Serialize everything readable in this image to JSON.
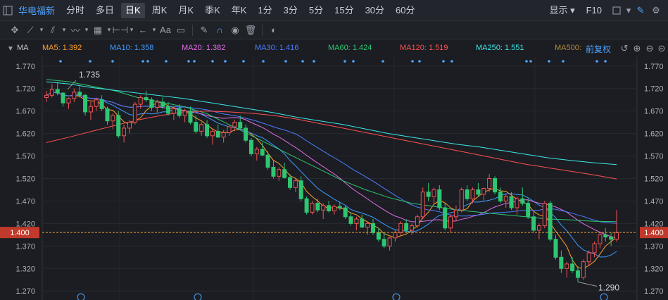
{
  "toolbar": {
    "stock_name": "华电福新",
    "periods": [
      "分时",
      "多日",
      "日K",
      "周K",
      "月K",
      "季K",
      "年K",
      "1分",
      "3分",
      "5分",
      "15分",
      "30分",
      "60分"
    ],
    "active_period": "日K",
    "display_label": "显示",
    "f10_label": "F10",
    "draw_tools": [
      "cursor-icon",
      "line-icon",
      "channel-icon",
      "wave-icon",
      "measure-icon",
      "interval-icon",
      "arrow-left-icon",
      "text-icon",
      "comment-icon",
      "pen-icon",
      "magnet-icon",
      "eye-icon",
      "trash-icon",
      "toggle-icon"
    ],
    "text_tool_label": "Aa"
  },
  "ma_bar": {
    "indicator": "MA",
    "items": [
      {
        "label": "MA5: 1.392",
        "color": "#ff9f2e"
      },
      {
        "label": "MA10: 1.358",
        "color": "#3d9bff"
      },
      {
        "label": "MA20: 1.382",
        "color": "#e26ee8"
      },
      {
        "label": "MA30: 1.416",
        "color": "#4a7dff"
      },
      {
        "label": "MA60: 1.424",
        "color": "#2ec672"
      },
      {
        "label": "MA120: 1.519",
        "color": "#ff5050"
      },
      {
        "label": "MA250: 1.551",
        "color": "#3ee6e6"
      },
      {
        "label": "MA500:",
        "color": "#b08a3a"
      }
    ],
    "adjust_label": "前复权",
    "controls": [
      "undo-icon",
      "zoom-in-icon",
      "zoom-out-icon",
      "minus-icon"
    ]
  },
  "chart_data": {
    "type": "candlestick",
    "y_ticks": [
      "1.770",
      "1.720",
      "1.670",
      "1.620",
      "1.570",
      "1.520",
      "1.470",
      "1.420",
      "1.370",
      "1.320",
      "1.270"
    ],
    "ylim": [
      1.25,
      1.79
    ],
    "current_price": "1.400",
    "annotations": [
      {
        "label": "1.735",
        "value": 1.735
      },
      {
        "label": "1.290",
        "value": 1.29
      }
    ],
    "up_color": "#f05454",
    "down_color": "#2ec672",
    "candles": [
      [
        1.7,
        1.715,
        1.69,
        1.705
      ],
      [
        1.705,
        1.73,
        1.7,
        1.718
      ],
      [
        1.718,
        1.735,
        1.705,
        1.71
      ],
      [
        1.71,
        1.712,
        1.68,
        1.688
      ],
      [
        1.688,
        1.7,
        1.675,
        1.698
      ],
      [
        1.698,
        1.72,
        1.69,
        1.712
      ],
      [
        1.712,
        1.725,
        1.7,
        1.705
      ],
      [
        1.705,
        1.708,
        1.66,
        1.668
      ],
      [
        1.668,
        1.69,
        1.65,
        1.68
      ],
      [
        1.68,
        1.7,
        1.67,
        1.695
      ],
      [
        1.695,
        1.705,
        1.67,
        1.675
      ],
      [
        1.675,
        1.68,
        1.64,
        1.648
      ],
      [
        1.648,
        1.665,
        1.63,
        1.66
      ],
      [
        1.66,
        1.67,
        1.61,
        1.615
      ],
      [
        1.615,
        1.64,
        1.6,
        1.632
      ],
      [
        1.632,
        1.65,
        1.62,
        1.645
      ],
      [
        1.645,
        1.69,
        1.64,
        1.685
      ],
      [
        1.685,
        1.705,
        1.675,
        1.7
      ],
      [
        1.7,
        1.715,
        1.69,
        1.695
      ],
      [
        1.695,
        1.7,
        1.67,
        1.678
      ],
      [
        1.678,
        1.695,
        1.665,
        1.69
      ],
      [
        1.69,
        1.7,
        1.675,
        1.68
      ],
      [
        1.68,
        1.69,
        1.66,
        1.665
      ],
      [
        1.665,
        1.68,
        1.65,
        1.675
      ],
      [
        1.675,
        1.685,
        1.655,
        1.66
      ],
      [
        1.66,
        1.675,
        1.645,
        1.67
      ],
      [
        1.67,
        1.68,
        1.64,
        1.645
      ],
      [
        1.645,
        1.66,
        1.62,
        1.625
      ],
      [
        1.625,
        1.645,
        1.615,
        1.64
      ],
      [
        1.64,
        1.65,
        1.61,
        1.615
      ],
      [
        1.615,
        1.63,
        1.595,
        1.625
      ],
      [
        1.625,
        1.64,
        1.61,
        1.612
      ],
      [
        1.612,
        1.628,
        1.6,
        1.622
      ],
      [
        1.622,
        1.64,
        1.615,
        1.635
      ],
      [
        1.635,
        1.65,
        1.625,
        1.645
      ],
      [
        1.645,
        1.66,
        1.63,
        1.632
      ],
      [
        1.632,
        1.64,
        1.6,
        1.605
      ],
      [
        1.605,
        1.61,
        1.57,
        1.575
      ],
      [
        1.575,
        1.59,
        1.56,
        1.585
      ],
      [
        1.585,
        1.6,
        1.57,
        1.572
      ],
      [
        1.572,
        1.58,
        1.54,
        1.545
      ],
      [
        1.545,
        1.56,
        1.52,
        1.525
      ],
      [
        1.525,
        1.545,
        1.515,
        1.54
      ],
      [
        1.54,
        1.555,
        1.52,
        1.522
      ],
      [
        1.522,
        1.53,
        1.495,
        1.5
      ],
      [
        1.5,
        1.52,
        1.49,
        1.515
      ],
      [
        1.515,
        1.525,
        1.47,
        1.475
      ],
      [
        1.475,
        1.48,
        1.44,
        1.445
      ],
      [
        1.445,
        1.47,
        1.44,
        1.465
      ],
      [
        1.465,
        1.475,
        1.445,
        1.45
      ],
      [
        1.45,
        1.465,
        1.43,
        1.46
      ],
      [
        1.46,
        1.47,
        1.445,
        1.448
      ],
      [
        1.448,
        1.462,
        1.44,
        1.458
      ],
      [
        1.458,
        1.468,
        1.45,
        1.455
      ],
      [
        1.455,
        1.46,
        1.43,
        1.435
      ],
      [
        1.435,
        1.445,
        1.415,
        1.42
      ],
      [
        1.42,
        1.435,
        1.405,
        1.43
      ],
      [
        1.43,
        1.44,
        1.41,
        1.412
      ],
      [
        1.412,
        1.425,
        1.395,
        1.42
      ],
      [
        1.42,
        1.43,
        1.395,
        1.4
      ],
      [
        1.4,
        1.41,
        1.38,
        1.385
      ],
      [
        1.385,
        1.4,
        1.365,
        1.37
      ],
      [
        1.37,
        1.39,
        1.36,
        1.388
      ],
      [
        1.388,
        1.405,
        1.38,
        1.4
      ],
      [
        1.4,
        1.425,
        1.395,
        1.42
      ],
      [
        1.42,
        1.43,
        1.4,
        1.405
      ],
      [
        1.405,
        1.42,
        1.395,
        1.415
      ],
      [
        1.415,
        1.44,
        1.41,
        1.435
      ],
      [
        1.435,
        1.5,
        1.43,
        1.49
      ],
      [
        1.49,
        1.51,
        1.47,
        1.48
      ],
      [
        1.48,
        1.5,
        1.465,
        1.495
      ],
      [
        1.495,
        1.505,
        1.45,
        1.455
      ],
      [
        1.455,
        1.465,
        1.405,
        1.41
      ],
      [
        1.41,
        1.44,
        1.4,
        1.435
      ],
      [
        1.435,
        1.46,
        1.425,
        1.45
      ],
      [
        1.45,
        1.5,
        1.445,
        1.495
      ],
      [
        1.495,
        1.505,
        1.47,
        1.475
      ],
      [
        1.475,
        1.5,
        1.465,
        1.495
      ],
      [
        1.495,
        1.51,
        1.48,
        1.485
      ],
      [
        1.485,
        1.5,
        1.47,
        1.498
      ],
      [
        1.498,
        1.53,
        1.49,
        1.52
      ],
      [
        1.52,
        1.525,
        1.485,
        1.49
      ],
      [
        1.49,
        1.5,
        1.465,
        1.47
      ],
      [
        1.47,
        1.485,
        1.455,
        1.48
      ],
      [
        1.48,
        1.49,
        1.45,
        1.455
      ],
      [
        1.455,
        1.48,
        1.44,
        1.475
      ],
      [
        1.475,
        1.5,
        1.46,
        1.465
      ],
      [
        1.465,
        1.475,
        1.43,
        1.435
      ],
      [
        1.435,
        1.445,
        1.4,
        1.405
      ],
      [
        1.405,
        1.42,
        1.385,
        1.415
      ],
      [
        1.415,
        1.47,
        1.41,
        1.465
      ],
      [
        1.465,
        1.47,
        1.38,
        1.385
      ],
      [
        1.385,
        1.395,
        1.34,
        1.345
      ],
      [
        1.345,
        1.36,
        1.31,
        1.32
      ],
      [
        1.32,
        1.335,
        1.3,
        1.33
      ],
      [
        1.33,
        1.345,
        1.31,
        1.315
      ],
      [
        1.315,
        1.325,
        1.29,
        1.3
      ],
      [
        1.3,
        1.34,
        1.295,
        1.335
      ],
      [
        1.335,
        1.36,
        1.325,
        1.355
      ],
      [
        1.355,
        1.38,
        1.345,
        1.375
      ],
      [
        1.375,
        1.4,
        1.365,
        1.395
      ],
      [
        1.395,
        1.41,
        1.38,
        1.39
      ],
      [
        1.39,
        1.4,
        1.37,
        1.385
      ],
      [
        1.385,
        1.45,
        1.38,
        1.4
      ]
    ],
    "ma_lines": [
      {
        "name": "MA5",
        "color": "#ff9f2e"
      },
      {
        "name": "MA10",
        "color": "#3d9bff"
      },
      {
        "name": "MA20",
        "color": "#e26ee8"
      },
      {
        "name": "MA30",
        "color": "#4a7dff"
      },
      {
        "name": "MA60",
        "color": "#2ec672",
        "values": [
          1.74,
          1.735,
          1.725,
          1.715,
          1.7,
          1.69,
          1.68,
          1.665,
          1.64,
          1.615,
          1.59,
          1.565,
          1.54,
          1.515,
          1.495,
          1.478,
          1.465,
          1.458,
          1.45,
          1.445,
          1.44,
          1.435,
          1.43,
          1.428,
          1.425,
          1.424
        ]
      },
      {
        "name": "MA120",
        "color": "#ff5050",
        "values": [
          1.6,
          1.612,
          1.625,
          1.638,
          1.65,
          1.66,
          1.668,
          1.67,
          1.668,
          1.665,
          1.66,
          1.652,
          1.642,
          1.632,
          1.622,
          1.612,
          1.602,
          1.592,
          1.582,
          1.572,
          1.562,
          1.552,
          1.544,
          1.536,
          1.528,
          1.519
        ]
      },
      {
        "name": "MA250",
        "color": "#3ee6e6",
        "values": [
          1.735,
          1.73,
          1.722,
          1.716,
          1.71,
          1.704,
          1.698,
          1.69,
          1.682,
          1.674,
          1.666,
          1.656,
          1.648,
          1.64,
          1.63,
          1.62,
          1.612,
          1.604,
          1.596,
          1.59,
          1.582,
          1.574,
          1.566,
          1.56,
          1.555,
          1.551
        ]
      }
    ]
  }
}
